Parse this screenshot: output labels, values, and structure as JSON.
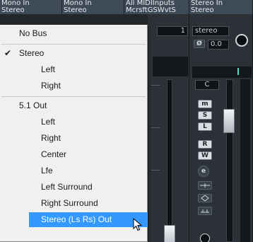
{
  "columns": [
    {
      "top": "Mono In",
      "bottom": "Stereo"
    },
    {
      "top": "Mono In",
      "bottom": "Stereo"
    },
    {
      "top": "All MIDIInputs",
      "bottom": "McrsftGSWvtS"
    },
    {
      "top": "Stereo In",
      "bottom": "Stereo"
    }
  ],
  "strip": {
    "midi_channel": "1",
    "bus_field": "stereo",
    "mute_icon_label": "Ø",
    "volume_value": "0.0",
    "channel_letter": "C",
    "buttons": [
      "m",
      "S",
      "L",
      "R",
      "W",
      "e"
    ]
  },
  "menu": {
    "items": [
      {
        "label": "No Bus",
        "indent": 1,
        "checked": false,
        "selected": false,
        "sep_before": false
      },
      {
        "label": "Stereo",
        "indent": 1,
        "checked": true,
        "selected": false,
        "sep_before": true
      },
      {
        "label": "Left",
        "indent": 2,
        "checked": false,
        "selected": false,
        "sep_before": false
      },
      {
        "label": "Right",
        "indent": 2,
        "checked": false,
        "selected": false,
        "sep_before": false
      },
      {
        "label": "5.1 Out",
        "indent": 1,
        "checked": false,
        "selected": false,
        "sep_before": true
      },
      {
        "label": "Left",
        "indent": 2,
        "checked": false,
        "selected": false,
        "sep_before": false
      },
      {
        "label": "Right",
        "indent": 2,
        "checked": false,
        "selected": false,
        "sep_before": false
      },
      {
        "label": "Center",
        "indent": 2,
        "checked": false,
        "selected": false,
        "sep_before": false
      },
      {
        "label": "Lfe",
        "indent": 2,
        "checked": false,
        "selected": false,
        "sep_before": false
      },
      {
        "label": "Left Surround",
        "indent": 2,
        "checked": false,
        "selected": false,
        "sep_before": false
      },
      {
        "label": "Right Surround",
        "indent": 2,
        "checked": false,
        "selected": false,
        "sep_before": false
      },
      {
        "label": "Stereo (Ls Rs) Out",
        "indent": 2,
        "checked": false,
        "selected": true,
        "sep_before": false
      }
    ],
    "check_glyph": "✔"
  },
  "colors": {
    "header_bg": "#3e4a55",
    "strip_bg": "#2b3137",
    "menu_bg": "#f0f0f0",
    "selection": "#3399ff"
  }
}
